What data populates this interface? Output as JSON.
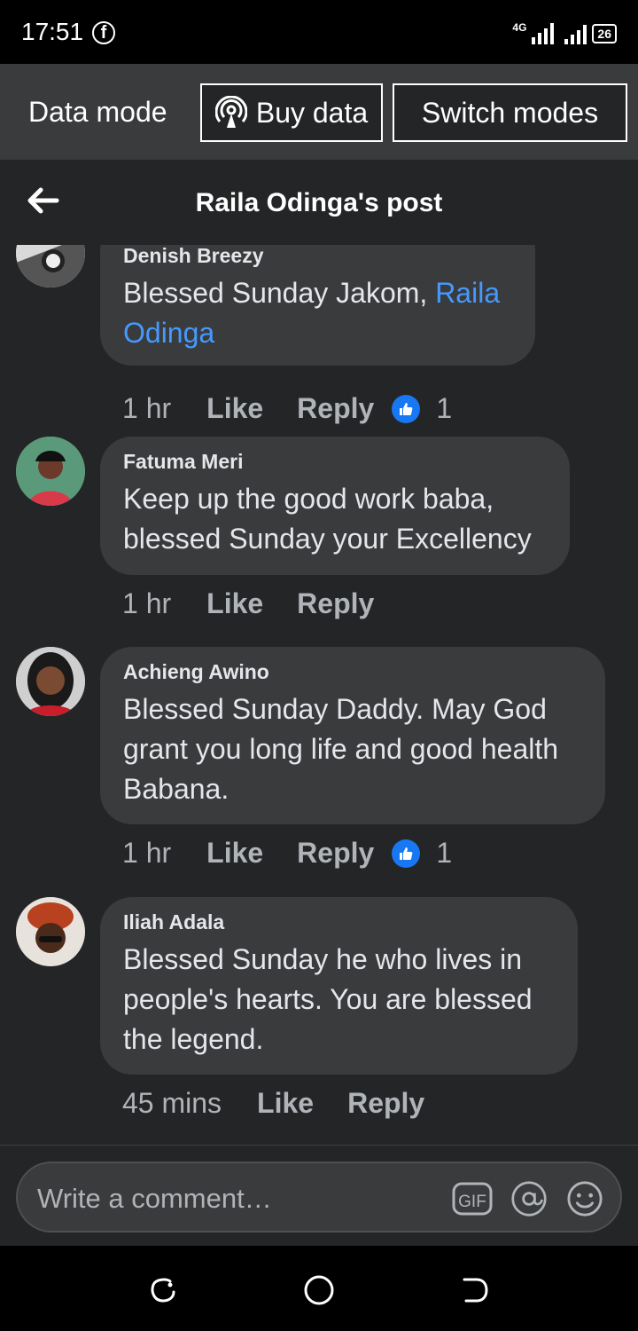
{
  "status_bar": {
    "time": "17:51",
    "network": "4G",
    "battery": "26"
  },
  "data_bar": {
    "label": "Data mode",
    "buy_label": "Buy data",
    "switch_label": "Switch modes"
  },
  "header": {
    "title": "Raila Odinga's post"
  },
  "comments": [
    {
      "author": "Denish Breezy",
      "text": "Blessed Sunday Jakom, ",
      "mention": "Raila Odinga",
      "time": "1 hr",
      "like": "Like",
      "reply": "Reply",
      "reactions": "1"
    },
    {
      "author": "Fatuma Meri",
      "text": "Keep up the good work baba, blessed Sunday your Excellency",
      "time": "1 hr",
      "like": "Like",
      "reply": "Reply"
    },
    {
      "author": "Achieng Awino",
      "text": "Blessed Sunday Daddy. May God grant you long life and good health Babana.",
      "time": "1 hr",
      "like": "Like",
      "reply": "Reply",
      "reactions": "1"
    },
    {
      "author": "Iliah Adala",
      "text": "Blessed Sunday he who lives in people's hearts. You are blessed the legend.",
      "time": "45 mins",
      "like": "Like",
      "reply": "Reply"
    }
  ],
  "composer": {
    "placeholder": "Write a comment…",
    "gif_label": "GIF"
  },
  "colors": {
    "background": "#242526",
    "bubble": "#3a3b3c",
    "mention": "#4599ff",
    "like_blue": "#1877f2",
    "meta_text": "#b0b3b8"
  },
  "icons": [
    "facebook-icon",
    "signal-icon",
    "battery-icon",
    "broadcast-icon",
    "back-arrow-icon",
    "like-reaction-icon",
    "gif-icon",
    "at-mention-icon",
    "emoji-icon",
    "recents-icon",
    "home-icon",
    "back-nav-icon"
  ]
}
